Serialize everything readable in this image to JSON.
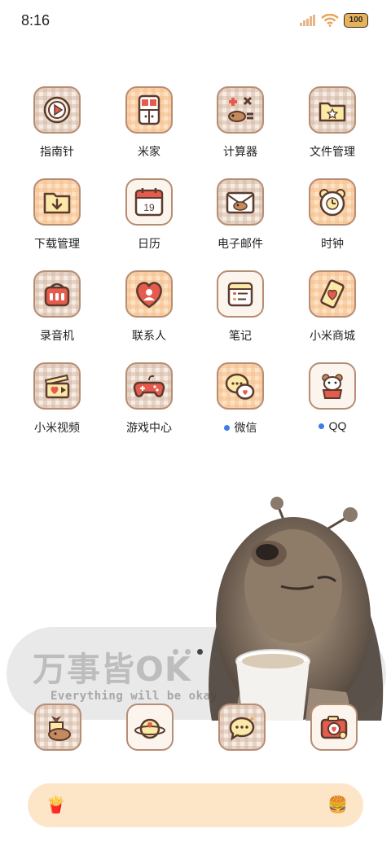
{
  "status_bar": {
    "time": "8:16",
    "battery": "100"
  },
  "apps": [
    {
      "label": "指南针",
      "notify": false
    },
    {
      "label": "米家",
      "notify": false
    },
    {
      "label": "计算器",
      "notify": false
    },
    {
      "label": "文件管理",
      "notify": false
    },
    {
      "label": "下载管理",
      "notify": false
    },
    {
      "label": "日历",
      "notify": false,
      "icon_text": "19"
    },
    {
      "label": "电子邮件",
      "notify": false
    },
    {
      "label": "时钟",
      "notify": false
    },
    {
      "label": "录音机",
      "notify": false
    },
    {
      "label": "联系人",
      "notify": false
    },
    {
      "label": "笔记",
      "notify": false
    },
    {
      "label": "小米商城",
      "notify": false
    },
    {
      "label": "小米视频",
      "notify": false
    },
    {
      "label": "游戏中心",
      "notify": false
    },
    {
      "label": "微信",
      "notify": true
    },
    {
      "label": "QQ",
      "notify": true
    }
  ],
  "widget": {
    "title": "万事皆OK",
    "subtitle": "Everything will be okay"
  },
  "page_indicator": {
    "count": 3,
    "active": 3
  },
  "dock": [
    {
      "icon": "dog-gift-icon"
    },
    {
      "icon": "planet-heart-icon"
    },
    {
      "icon": "chat-bubble-icon"
    },
    {
      "icon": "camera-icon"
    }
  ],
  "search_bar": {
    "left_icon": "🍟",
    "right_icon": "🍔"
  },
  "colors": {
    "accent_blue": "#3b7bea",
    "icon_border": "#b78d73",
    "search_bg": "#fde6c8"
  }
}
